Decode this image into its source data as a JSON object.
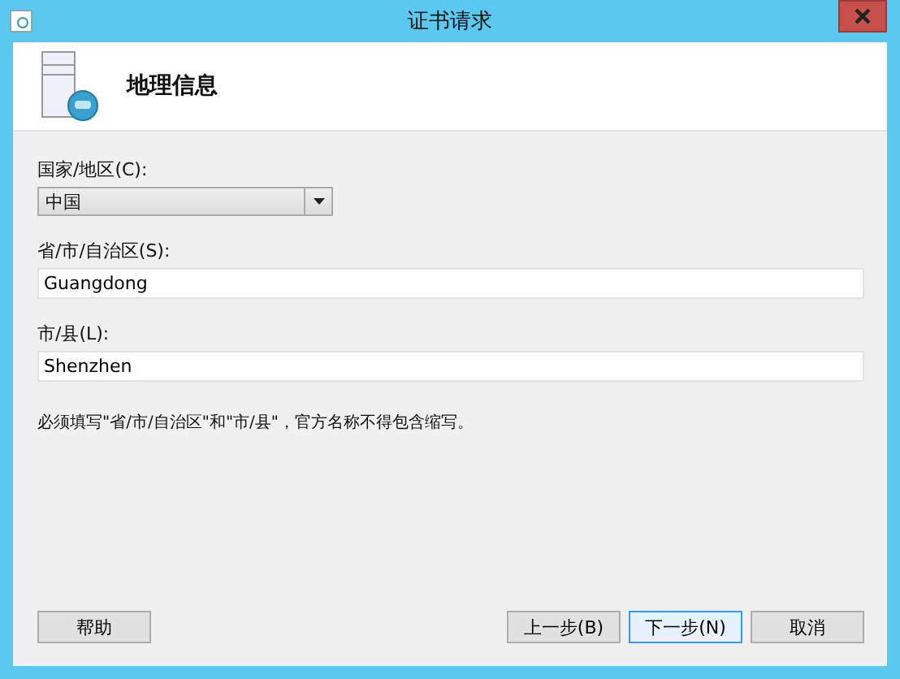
{
  "window": {
    "title": "证书请求"
  },
  "header": {
    "title": "地理信息"
  },
  "fields": [
    {
      "kind": "combo",
      "label": "国家/地区(C):",
      "value": "中国"
    },
    {
      "kind": "text",
      "label": "省/市/自治区(S):",
      "value": "Guangdong"
    },
    {
      "kind": "text",
      "label": "市/县(L):",
      "value": "Shenzhen"
    }
  ],
  "note": "必须填写\"省/市/自治区\"和\"市/县\"，官方名称不得包含缩写。",
  "buttons": [
    {
      "label": "帮助",
      "default": false
    },
    {
      "label": "上一步(B)",
      "default": false
    },
    {
      "label": "下一步(N)",
      "default": true
    },
    {
      "label": "取消",
      "default": false
    }
  ]
}
